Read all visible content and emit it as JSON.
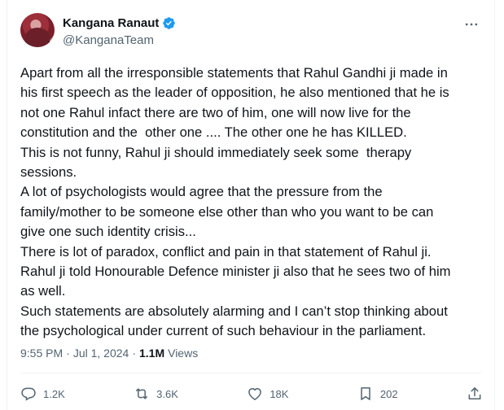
{
  "author": {
    "display_name": "Kangana Ranaut",
    "handle": "@KanganaTeam",
    "verified": true
  },
  "tweet": {
    "text": "Apart from all the irresponsible statements that Rahul Gandhi ji made in\nhis first speech as the leader of opposition, he also mentioned that he is\nnot one Rahul infact there are two of him, one will now live for the\nconstitution and the  other one .... The other one he has KILLED.\nThis is not funny, Rahul ji should immediately seek some  therapy\nsessions.\nA lot of psychologists would agree that the pressure from the\nfamily/mother to be someone else other than who you want to be can\ngive one such identity crisis...\nThere is lot of paradox, conflict and pain in that statement of Rahul ji.\nRahul ji told Honourable Defence minister ji also that he sees two of him\nas well.\nSuch statements are absolutely alarming and I can’t stop thinking about\nthe psychological under current of such behaviour in the parliament.",
    "time": "9:55 PM",
    "separator": "·",
    "date": "Jul 1, 2024",
    "views_count": "1.1M",
    "views_label": "Views"
  },
  "actions": {
    "replies": "1.2K",
    "reposts": "3.6K",
    "likes": "18K",
    "bookmarks": "202"
  },
  "icons": {
    "verified": "verified-badge-icon",
    "more": "more-horizontal-icon",
    "reply": "reply-icon",
    "repost": "repost-icon",
    "like": "heart-icon",
    "bookmark": "bookmark-icon",
    "share": "share-icon"
  },
  "colors": {
    "verified_blue": "#1d9bf0",
    "secondary_text": "#536471",
    "primary_text": "#0f1419"
  }
}
